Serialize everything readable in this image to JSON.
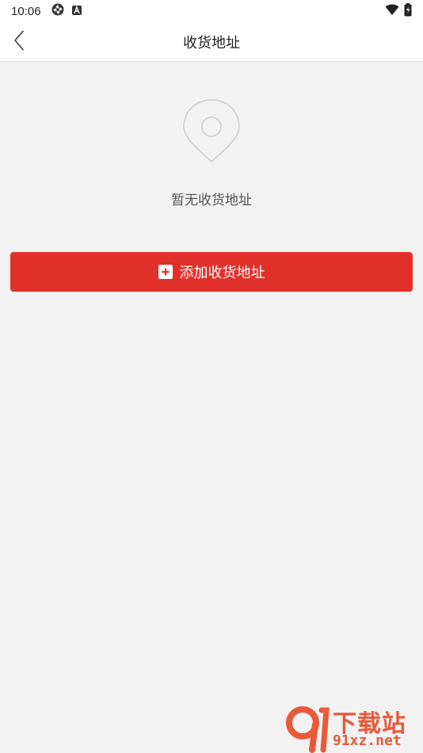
{
  "status_bar": {
    "time": "10:06",
    "icons_left": [
      "photos-icon",
      "accessibility-a-icon"
    ],
    "icons_right": [
      "wifi-icon",
      "battery-icon"
    ]
  },
  "nav": {
    "title": "收货地址",
    "back_icon": "chevron-left-icon"
  },
  "empty_state": {
    "icon": "location-pin-icon",
    "message": "暂无收货地址"
  },
  "add_address": {
    "label": "添加收货地址",
    "icon": "plus-square-icon"
  },
  "watermark": {
    "cn": "下载站",
    "en": "91xz.net"
  },
  "colors": {
    "primary": "#e1302a",
    "background": "#f2f2f2",
    "watermark": "#e85a3a"
  }
}
